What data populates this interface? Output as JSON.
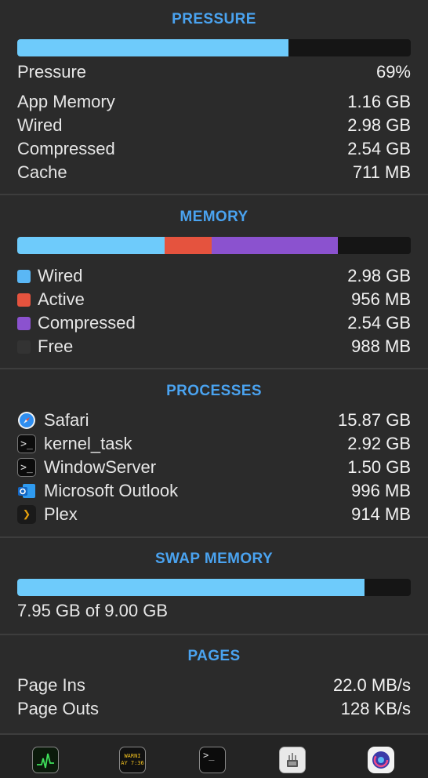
{
  "pressure": {
    "title": "PRESSURE",
    "bar_fraction": 0.69,
    "bar_color": "#6ecbfb",
    "rows": [
      {
        "label": "Pressure",
        "value": "69%"
      },
      {
        "label": "App Memory",
        "value": "1.16 GB"
      },
      {
        "label": "Wired",
        "value": "2.98 GB"
      },
      {
        "label": "Compressed",
        "value": "2.54 GB"
      },
      {
        "label": "Cache",
        "value": "711 MB"
      }
    ]
  },
  "memory": {
    "title": "MEMORY",
    "segments": [
      {
        "name": "Wired",
        "fraction": 0.375,
        "color": "#6ecbfb"
      },
      {
        "name": "Active",
        "fraction": 0.12,
        "color": "#e5533e"
      },
      {
        "name": "Compressed",
        "fraction": 0.32,
        "color": "#8b52cf"
      },
      {
        "name": "Free",
        "fraction": 0.185,
        "color": "#151515"
      }
    ],
    "rows": [
      {
        "label": "Wired",
        "value": "2.98 GB",
        "color": "#5ab7f5"
      },
      {
        "label": "Active",
        "value": "956 MB",
        "color": "#e5533e"
      },
      {
        "label": "Compressed",
        "value": "2.54 GB",
        "color": "#8b52cf"
      },
      {
        "label": "Free",
        "value": "988 MB",
        "color": "#333333"
      }
    ]
  },
  "processes": {
    "title": "PROCESSES",
    "rows": [
      {
        "label": "Safari",
        "value": "15.87 GB",
        "icon": "safari-icon"
      },
      {
        "label": "kernel_task",
        "value": "2.92 GB",
        "icon": "terminal-icon"
      },
      {
        "label": "WindowServer",
        "value": "1.50 GB",
        "icon": "terminal-icon"
      },
      {
        "label": "Microsoft Outlook",
        "value": "996 MB",
        "icon": "outlook-icon"
      },
      {
        "label": "Plex",
        "value": "914 MB",
        "icon": "plex-icon"
      }
    ]
  },
  "swap": {
    "title": "SWAP MEMORY",
    "bar_fraction": 0.883,
    "bar_color": "#6ecbfb",
    "text": "7.95 GB of 9.00 GB"
  },
  "pages": {
    "title": "PAGES",
    "rows": [
      {
        "label": "Page Ins",
        "value": "22.0 MB/s"
      },
      {
        "label": "Page Outs",
        "value": "128 KB/s"
      }
    ]
  },
  "footer": {
    "console_text_1": "WARNI",
    "console_text_2": "AY 7:36",
    "icons": [
      "activity-monitor-icon",
      "console-icon",
      "terminal-icon",
      "system-information-icon",
      "istat-menus-icon"
    ]
  }
}
